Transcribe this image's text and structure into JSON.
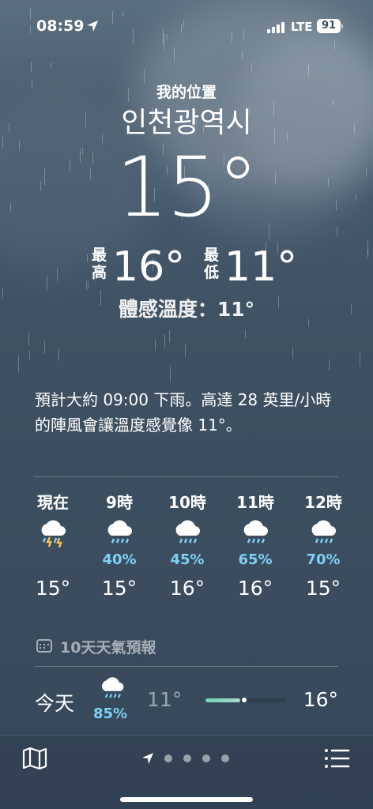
{
  "status_bar": {
    "time": "08:59",
    "network": "LTE",
    "battery": "91"
  },
  "header": {
    "location_label": "我的位置",
    "city": "인천광역시",
    "temperature": "15°",
    "high_label": "最高",
    "high_value": "16°",
    "low_label": "最低",
    "low_value": "11°",
    "feels_like": "體感溫度：11°"
  },
  "hourly": {
    "summary": "預計大約 09:00 下雨。高達 28 英里/小時的陣風會讓溫度感覺像 11°。",
    "items": [
      {
        "label": "現在",
        "icon": "thunderstorm-rain-icon",
        "pop": "",
        "temp": "15°"
      },
      {
        "label": "9時",
        "icon": "rain-cloud-icon",
        "pop": "40%",
        "temp": "15°"
      },
      {
        "label": "10時",
        "icon": "rain-cloud-icon",
        "pop": "45%",
        "temp": "16°"
      },
      {
        "label": "11時",
        "icon": "rain-cloud-icon",
        "pop": "65%",
        "temp": "16°"
      },
      {
        "label": "12時",
        "icon": "rain-cloud-icon",
        "pop": "70%",
        "temp": "15°"
      }
    ]
  },
  "ten_day": {
    "title": "10天天氣預報",
    "days": [
      {
        "name": "今天",
        "icon": "rain-cloud-icon",
        "pop": "85%",
        "low": "11°",
        "high": "16°"
      }
    ]
  },
  "bottom_bar": {
    "left_icon": "map-icon",
    "right_icon": "list-icon",
    "pages": 4
  },
  "colors": {
    "pop_blue": "#7fd0f5",
    "background": "#3f5263"
  }
}
